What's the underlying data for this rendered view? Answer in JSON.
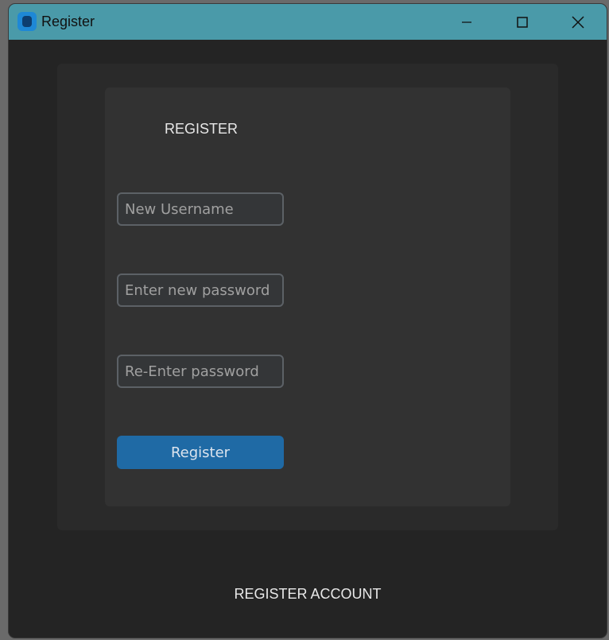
{
  "window": {
    "title": "Register",
    "controls": {
      "minimize_icon": "minimize-icon",
      "maximize_icon": "maximize-icon",
      "close_icon": "close-icon"
    }
  },
  "form": {
    "heading": "REGISTER",
    "username_placeholder": "New Username",
    "password_placeholder": "Enter new password",
    "confirm_password_placeholder": "Re-Enter password",
    "register_button_label": "Register"
  },
  "footer": {
    "label": "REGISTER ACCOUNT"
  },
  "colors": {
    "titlebar": "#4a9aa9",
    "window_bg": "#242424",
    "outer_frame": "#2a2a2a",
    "inner_frame": "#323232",
    "button_accent": "#1f6aa5",
    "field_border": "#5c6166"
  }
}
